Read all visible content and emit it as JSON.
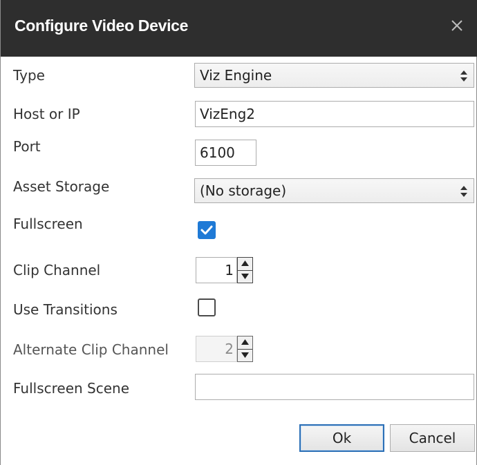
{
  "dialog": {
    "title": "Configure Video Device"
  },
  "icons": {
    "close": "close-icon",
    "check": "checkmark-icon",
    "select_arrow": "up-down-arrow-icon",
    "stepper_up": "triangle-up-icon",
    "stepper_down": "triangle-down-icon"
  },
  "fields": {
    "type": {
      "label": "Type",
      "value": "Viz Engine"
    },
    "host": {
      "label": "Host or IP",
      "value": "VizEng2"
    },
    "port": {
      "label": "Port",
      "value": "6100"
    },
    "asset_storage": {
      "label": "Asset Storage",
      "value": "(No storage)"
    },
    "fullscreen": {
      "label": "Fullscreen",
      "checked": true
    },
    "clip_channel": {
      "label": "Clip Channel",
      "value": "1"
    },
    "use_transitions": {
      "label": "Use Transitions",
      "checked": false
    },
    "alternate_clip_channel": {
      "label": "Alternate Clip Channel",
      "value": "2",
      "enabled": false
    },
    "fullscreen_scene": {
      "label": "Fullscreen Scene",
      "value": ""
    }
  },
  "buttons": {
    "ok": "Ok",
    "cancel": "Cancel"
  },
  "colors": {
    "titlebar": "#2e2e2e",
    "checkbox_checked": "#1f7ad6",
    "default_button_border": "#2b6fb6"
  }
}
